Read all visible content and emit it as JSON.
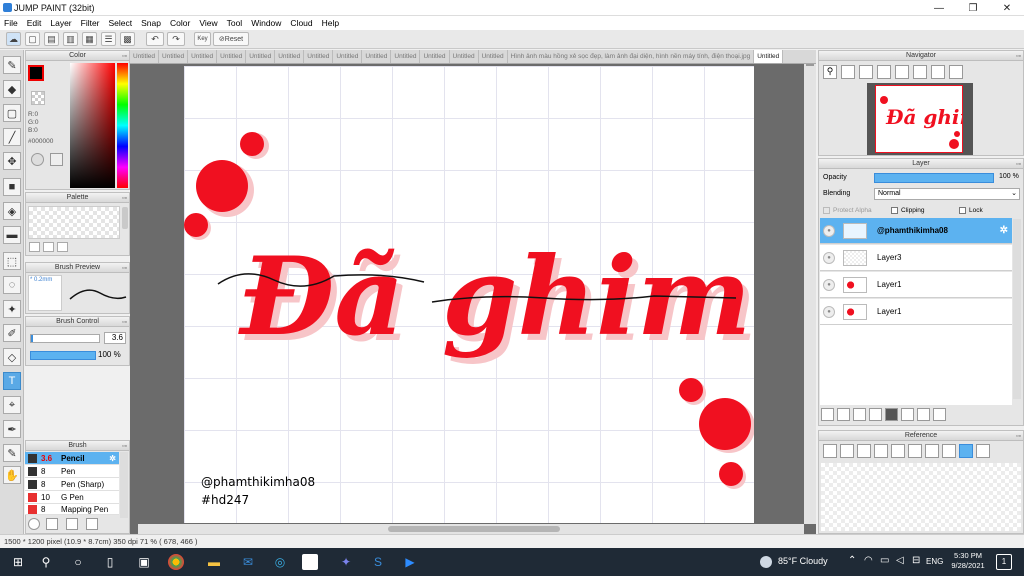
{
  "window": {
    "title": "JUMP PAINT (32bit)",
    "minimize": "—",
    "maximize": "❐",
    "close": "✕"
  },
  "menu": [
    "File",
    "Edit",
    "Layer",
    "Filter",
    "Select",
    "Snap",
    "Color",
    "View",
    "Tool",
    "Window",
    "Cloud",
    "Help"
  ],
  "toolbar": {
    "key_label": "Key",
    "reset_label": "Reset"
  },
  "color_panel": {
    "title": "Color",
    "r": "R:0",
    "g": "G:0",
    "b": "B:0",
    "hex": "#000000",
    "fg_color": "#000000"
  },
  "palette_panel": {
    "title": "Palette"
  },
  "brush_preview": {
    "title": "Brush Preview",
    "size": "* 0.2mm"
  },
  "brush_control": {
    "title": "Brush Control",
    "size_value": "3.6",
    "opacity_value": "100 %"
  },
  "brush_panel": {
    "title": "Brush",
    "items": [
      {
        "size": "3.6",
        "name": "Pencil",
        "color": "#222222"
      },
      {
        "size": "8",
        "name": "Pen",
        "color": "#222222"
      },
      {
        "size": "8",
        "name": "Pen (Sharp)",
        "color": "#222222"
      },
      {
        "size": "10",
        "name": "G Pen",
        "color": "#e83030"
      },
      {
        "size": "8",
        "name": "Mapping Pen",
        "color": "#e83030"
      }
    ]
  },
  "tabs": [
    "Untitled",
    "Untitled",
    "Untitled",
    "Untitled",
    "Untitled",
    "Untitled",
    "Untitled",
    "Untitled",
    "Untitled",
    "Untitled",
    "Untitled",
    "Untitled",
    "Untitled",
    "Hình ảnh màu hồng xẻ sọc đẹp, làm ảnh đại diện, hình nền máy tính, điện thoại.jpg",
    "Untitled"
  ],
  "artwork": {
    "title": "Đã ghim",
    "watermark": "@phamthikimha08",
    "hashtag": "#hd247",
    "accent": "#f01020"
  },
  "navigator": {
    "title": "Navigator"
  },
  "layer_panel": {
    "title": "Layer",
    "opacity_label": "Opacity",
    "opacity_value": "100 %",
    "blending_label": "Blending",
    "blending_value": "Normal",
    "protect_alpha": "Protect Alpha",
    "clipping": "Clipping",
    "lock": "Lock",
    "layers": [
      {
        "name": "@phamthikimha08",
        "selected": true
      },
      {
        "name": "Layer3",
        "selected": false
      },
      {
        "name": "Layer1",
        "selected": false
      },
      {
        "name": "Layer1",
        "selected": false
      }
    ]
  },
  "reference_panel": {
    "title": "Reference"
  },
  "status": {
    "text": "1500 * 1200 pixel   (10.9 * 8.7cm)   350 dpi   71 %   ( 678, 466 )"
  },
  "taskbar": {
    "weather": "85°F Cloudy",
    "lang": "ENG",
    "time": "5:30 PM",
    "date": "9/28/2021",
    "notif": "1"
  }
}
